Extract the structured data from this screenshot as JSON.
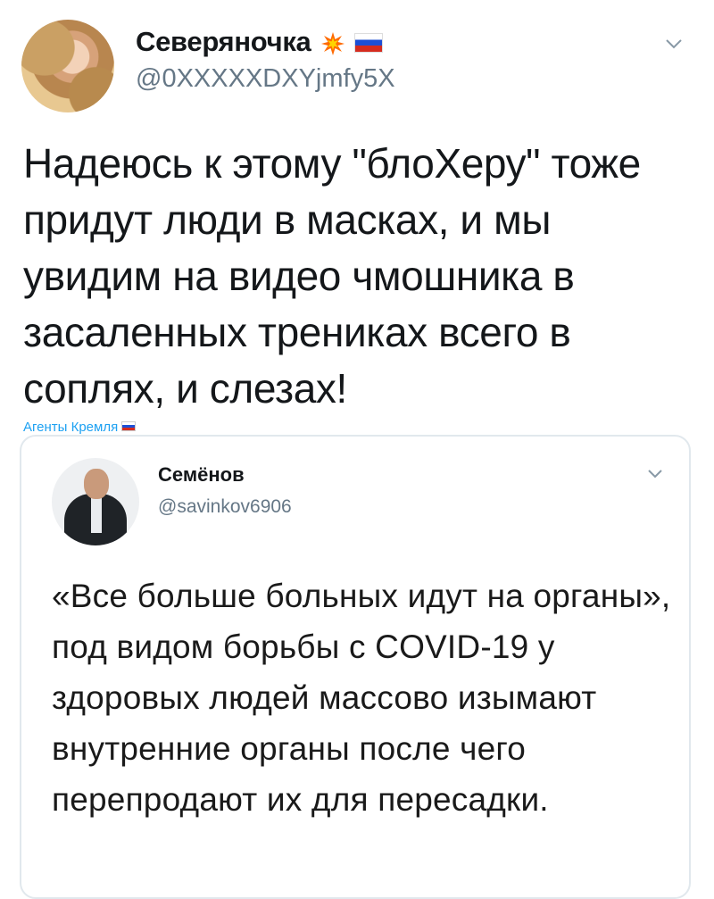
{
  "tweet": {
    "display_name": "Северяночка",
    "badge_icons": [
      "collision-icon",
      "russian-flag-icon"
    ],
    "handle": "@0XXXXXDXYjmfy5X",
    "text": "Надеюсь к этому \"блоХеру\" тоже придут люди в масках, и мы увидим на видео чмошника в засаленных трениках всего в соплях, и слезах!",
    "source": "Агенты Кремля",
    "menu_icon": "chevron-down-icon"
  },
  "quoted_tweet": {
    "display_name": "Семёнов",
    "handle": "@savinkov6906",
    "text": "«Все больше больных идут на органы», под видом борьбы с COVID-19 у здоровых людей массово изымают внутренние органы после чего перепродают их для пересадки.",
    "menu_icon": "chevron-down-icon"
  },
  "colors": {
    "link": "#1da1f2",
    "secondary_text": "#657786",
    "border": "#e1e8ed"
  }
}
